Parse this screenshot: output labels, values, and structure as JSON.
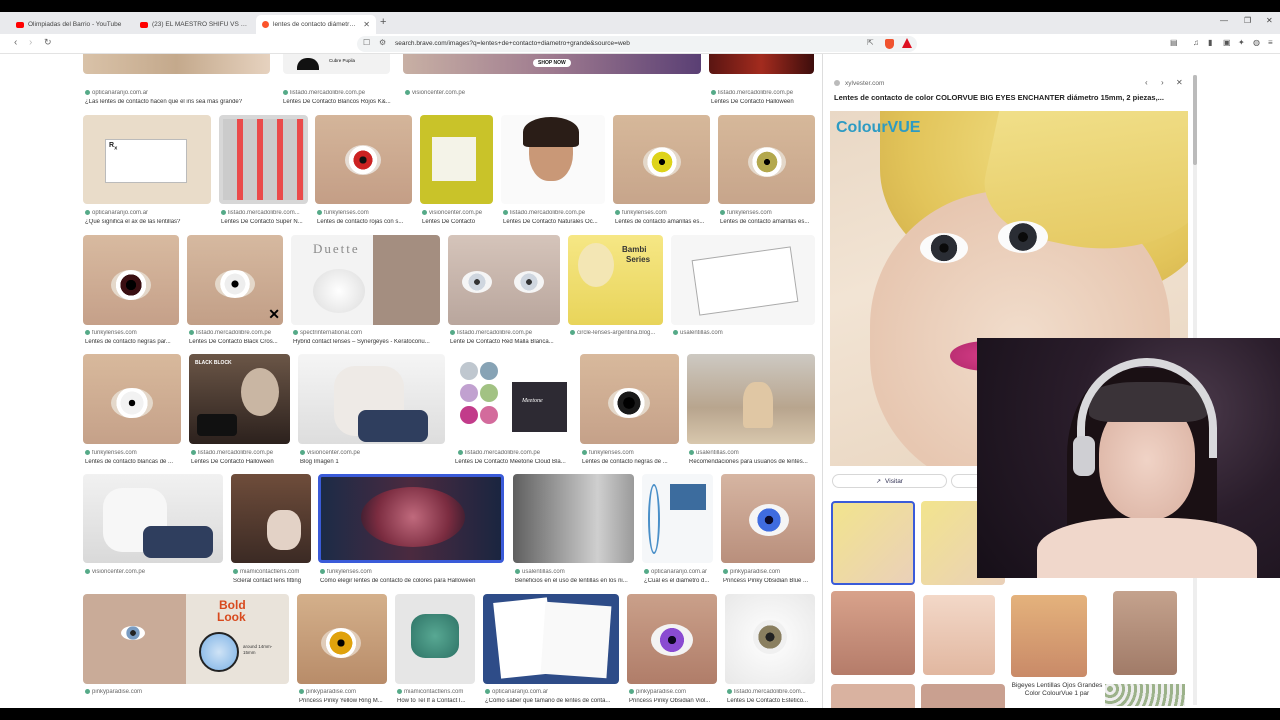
{
  "tabs": [
    {
      "label": "Olimpiadas del Barrio - YouTube",
      "icon": "youtube-icon"
    },
    {
      "label": "(23) EL MAESTRO SHIFU VS 33 MUJ...",
      "icon": "youtube-icon"
    },
    {
      "label": "lentes de contacto diámetro gra...",
      "icon": "brave-icon"
    }
  ],
  "toolbar": {
    "url": "search.brave.com/images?q=lentes+de+contacto+diametro+grande&source=web"
  },
  "results": {
    "row0": [
      {
        "source": "opticanaranjo.com.ar",
        "caption": "¿Las lentes de contacto hacen que el iris sea más grande?"
      },
      {
        "source": "listado.mercadolibre.com.pe",
        "caption": "Lentes De Contacto Blancos Rojos K&..."
      },
      {
        "source": "visioncenter.com.pe",
        "caption": ""
      },
      {
        "source": "listado.mercadolibre.com.pe",
        "caption": "Lentes De Contacto Halloween"
      }
    ],
    "row1": [
      {
        "source": "opticanaranjo.com.ar",
        "caption": "¿Qué significa el ax de las lentillas?"
      },
      {
        "source": "listado.mercadolibre.com...",
        "caption": "Lentes De Contacto Super N..."
      },
      {
        "source": "funkylenses.com",
        "caption": "Lentes de contacto rojas con s..."
      },
      {
        "source": "visioncenter.com.pe",
        "caption": "Lentes De Contacto"
      },
      {
        "source": "listado.mercadolibre.com.pe",
        "caption": "Lentes De Contacto Naturales Oc..."
      },
      {
        "source": "funkylenses.com",
        "caption": "Lentes de contacto amarillas es..."
      },
      {
        "source": "funkylenses.com",
        "caption": "Lentes de contacto amarillas es..."
      }
    ],
    "row2": [
      {
        "source": "funkylenses.com",
        "caption": "Lentes de contacto negras par..."
      },
      {
        "source": "listado.mercadolibre.com.pe",
        "caption": "Lentes De Contacto Black Cros..."
      },
      {
        "source": "spectrinternational.com",
        "caption": "Hybrid contact lenses – Synergeyes - Keratoconu..."
      },
      {
        "source": "listado.mercadolibre.com.pe",
        "caption": "Lente De Contacto Red Malla Blanca..."
      },
      {
        "source": "circle-lenses-argentina.blog...",
        "caption": ""
      },
      {
        "source": "usalentillas.com",
        "caption": ""
      }
    ],
    "row3": [
      {
        "source": "funkylenses.com",
        "caption": "Lentes de contacto blancas de ..."
      },
      {
        "source": "listado.mercadolibre.com.pe",
        "caption": "Lentes De Contacto Halloween"
      },
      {
        "source": "visioncenter.com.pe",
        "caption": "Blog Imagen 1"
      },
      {
        "source": "listado.mercadolibre.com.pe",
        "caption": "Lentes De Contacto Meetone Cloud Bla..."
      },
      {
        "source": "funkylenses.com",
        "caption": "Lentes de contacto negras de ..."
      },
      {
        "source": "usalentillas.com",
        "caption": "Recomendaciones para usuarios de lentes..."
      }
    ],
    "row4": [
      {
        "source": "visioncenter.com.pe",
        "caption": ""
      },
      {
        "source": "miamicontactlens.com",
        "caption": "Scleral contact lens fitting"
      },
      {
        "source": "funkylenses.com",
        "caption": "Cómo elegir lentes de contacto de colores para Halloween"
      },
      {
        "source": "usalentillas.com",
        "caption": "Beneficios en el uso de lentillas en los ni..."
      },
      {
        "source": "opticanaranjo.com.ar",
        "caption": "¿Cuál es el diámetro d..."
      },
      {
        "source": "pinkyparadise.com",
        "caption": "Princess Pinky Obsidian Blue ..."
      }
    ],
    "row5": [
      {
        "source": "pinkyparadise.com",
        "caption": ""
      },
      {
        "source": "pinkyparadise.com",
        "caption": "Princess Pinky Yellow Ring M..."
      },
      {
        "source": "miamicontactlens.com",
        "caption": "How to Tel If a Contact I..."
      },
      {
        "source": "opticanaranjo.com.ar",
        "caption": "¿Cómo saber qué tamaño de lentes de conta..."
      },
      {
        "source": "pinkyparadise.com",
        "caption": "Princess Pinky Obsidian Viol..."
      },
      {
        "source": "listado.mercadolibre.com...",
        "caption": "Lentes De Contacto Estetico..."
      }
    ],
    "thumb_text": {
      "shop_now": "SHOP NOW",
      "duette": "Duette",
      "bambi": "Bambi",
      "series": "Series",
      "black_block": "BLACK BLOCK",
      "meetone": "Meetone",
      "bold": "Bold",
      "look": "Look",
      "around": "around 14mm-15mm",
      "cubre": "Cubre Pupila"
    }
  },
  "panel": {
    "source": "xylvester.com",
    "title": "Lentes de contacto de color COLORVUE BIG EYES ENCHANTER diámetro 15mm, 2 piezas,...",
    "logo": "ColourVUE",
    "visit_label": "Visitar",
    "related_caption": "Bigeyes Lentillas Ojos Grandes Color ColourVue 1 par"
  },
  "colors": {
    "accent": "#3a5bd9",
    "brave_orange": "#fb542b",
    "youtube_red": "#ff0000"
  }
}
